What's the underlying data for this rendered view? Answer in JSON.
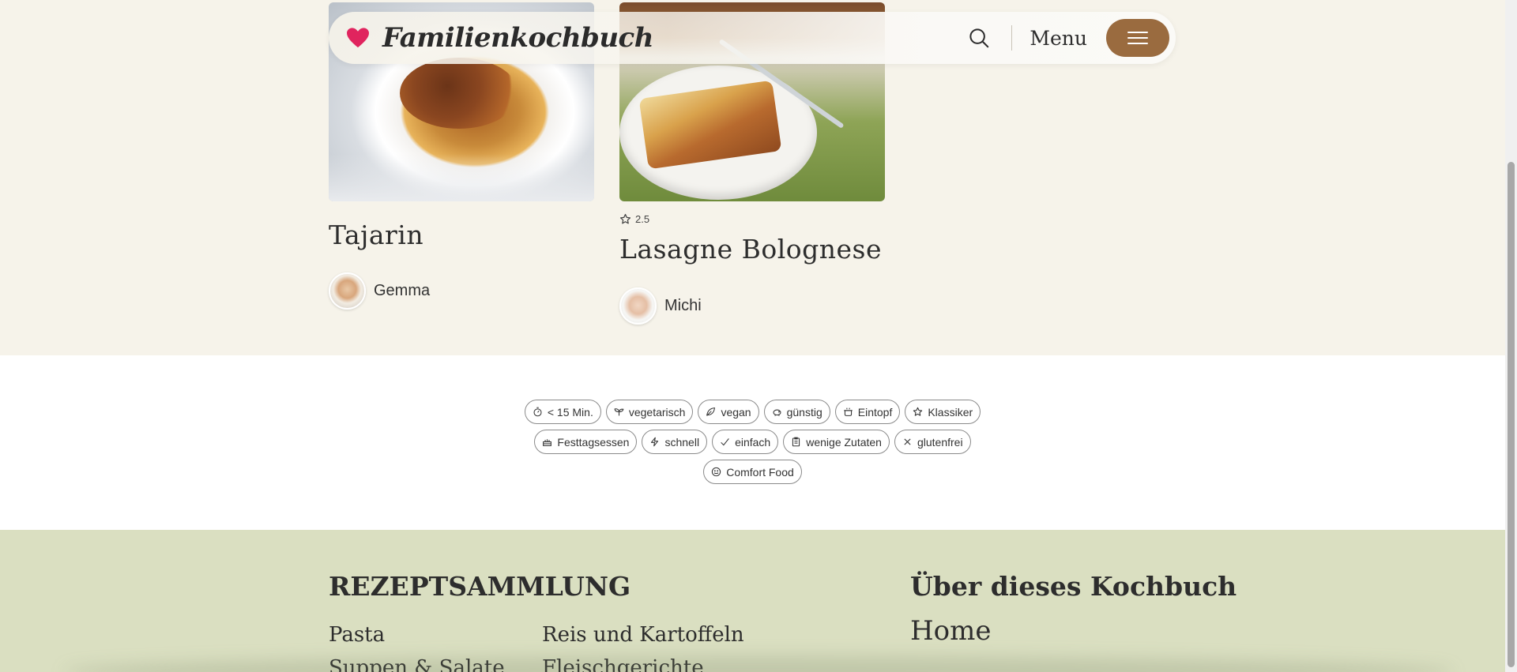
{
  "header": {
    "brand_name": "Familienkochbuch",
    "menu_label": "Menu",
    "brand_color": "#e0245e",
    "menu_button_color": "#9a6b3f"
  },
  "recipes": [
    {
      "title": "Tajarin",
      "author": "Gemma",
      "rating": ""
    },
    {
      "title": "Lasagne Bolognese",
      "author": "Michi",
      "rating": "2.5"
    }
  ],
  "tags": {
    "row1": [
      "< 15 Min.",
      "vegetarisch",
      "vegan",
      "günstig",
      "Eintopf",
      "Klassiker"
    ],
    "row2": [
      "Festtagsessen",
      "schnell",
      "einfach",
      "wenige Zutaten",
      "glutenfrei"
    ],
    "row3": [
      "Comfort Food"
    ]
  },
  "tag_icons": [
    "timer-icon",
    "sprout-icon",
    "leaf-icon",
    "piggy-bank-icon",
    "pot-icon",
    "star-icon",
    "cake-icon",
    "lightning-icon",
    "check-icon",
    "clipboard-icon",
    "x-icon",
    "smile-icon"
  ],
  "footer": {
    "collection_heading": "REZEPTSAMMLUNG",
    "collection_links": [
      "Pasta",
      "Reis und Kartoffeln",
      "Suppen & Salate",
      "Fleischgerichte"
    ],
    "about_heading": "Über dieses Kochbuch",
    "about_links": [
      "Home"
    ],
    "background_color": "#dadfc1"
  }
}
